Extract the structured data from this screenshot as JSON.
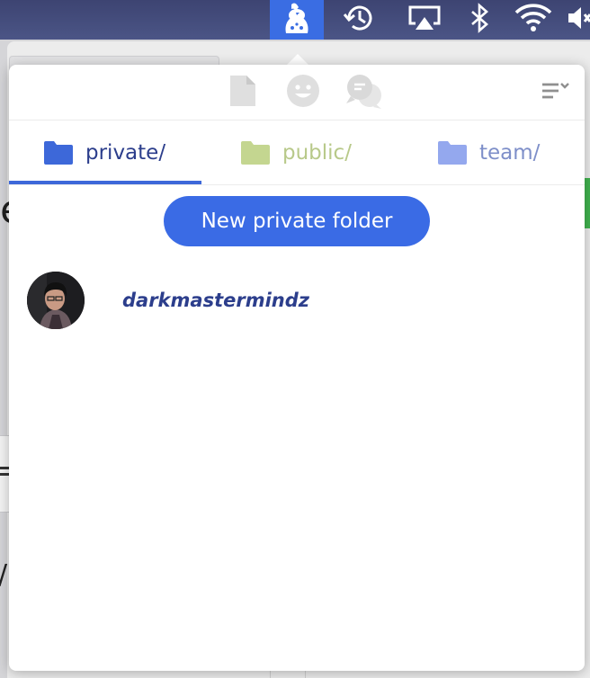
{
  "menubar": {
    "icons": [
      "keybase-icon",
      "time-machine-icon",
      "airplay-icon",
      "bluetooth-icon",
      "wifi-icon",
      "volume-muted-icon"
    ],
    "colors": {
      "bar": "#434c7c",
      "keybase_highlight": "#3a6de3",
      "icon": "#ffffff"
    }
  },
  "popover": {
    "header": {
      "icons": [
        "document-icon",
        "emoji-icon",
        "chat-icon",
        "menu-icon"
      ]
    },
    "tabs": [
      {
        "label": "private/",
        "color": "#2c3e8c",
        "folder_color": "#3d68d9",
        "selected": true
      },
      {
        "label": "public/",
        "color": "#b8c98a",
        "folder_color": "#c4d690",
        "selected": false
      },
      {
        "label": "team/",
        "color": "#7e8fc9",
        "folder_color": "#94a8ee",
        "selected": false
      }
    ],
    "new_folder_button": {
      "label": "New private folder",
      "color": "#3a6be5"
    },
    "users": [
      {
        "username": "darkmastermindz"
      }
    ]
  }
}
